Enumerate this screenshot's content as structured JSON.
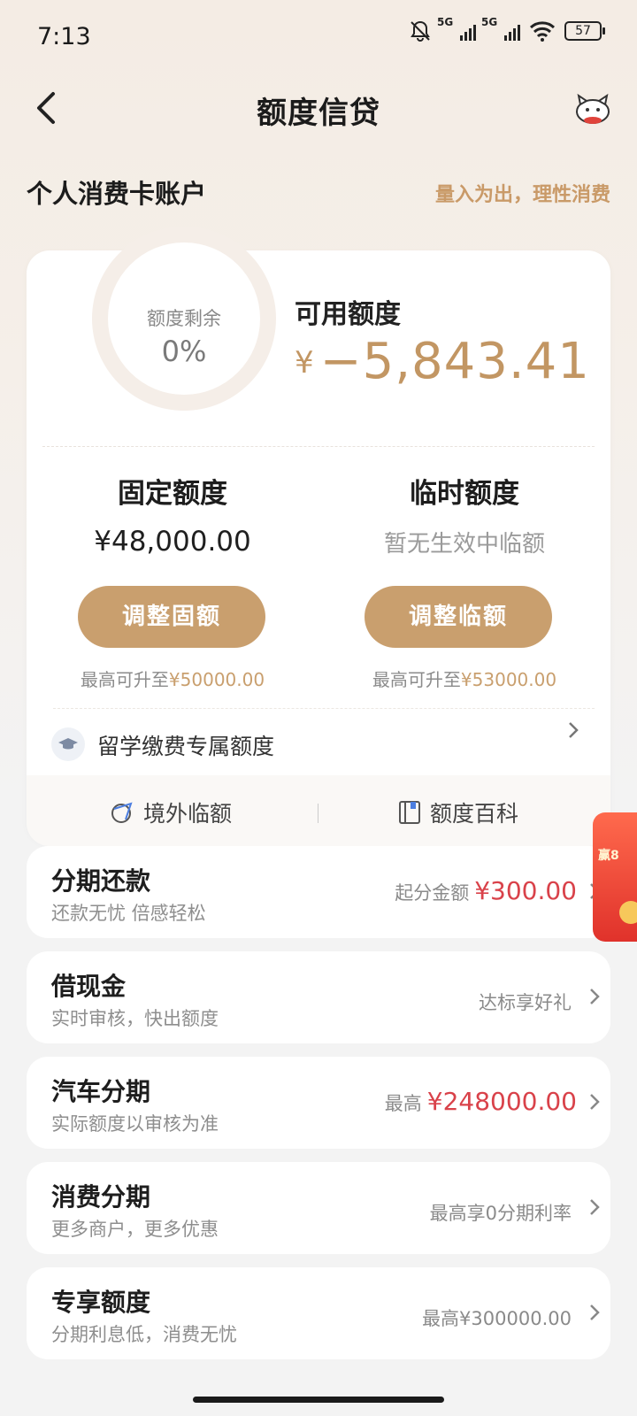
{
  "status_bar": {
    "time": "7:13",
    "signal1_label": "5G",
    "signal2_label": "5G",
    "battery": "57"
  },
  "nav": {
    "title": "额度信贷"
  },
  "section": {
    "title": "个人消费卡账户",
    "slogan": "量入为出，理性消费"
  },
  "quota_ring": {
    "label": "额度剩余",
    "value": "0%",
    "fraction": 0
  },
  "available": {
    "label": "可用额度",
    "currency": "¥",
    "amount": "−5,843.41"
  },
  "fixed": {
    "title": "固定额度",
    "amount": "¥48,000.00",
    "button": "调整固额",
    "max_prefix": "最高可升至",
    "max_value": "¥50000.00"
  },
  "temporary": {
    "title": "临时额度",
    "status": "暂无生效中临额",
    "button": "调整临额",
    "max_prefix": "最高可升至",
    "max_value": "¥53000.00"
  },
  "study": {
    "label": "留学缴费专属额度"
  },
  "footer_links": {
    "overseas": "境外临额",
    "wiki": "额度百科"
  },
  "list": [
    {
      "title": "分期还款",
      "subtitle": "还款无忧 倍感轻松",
      "right_prefix": "起分金额",
      "right_value": "¥300.00"
    },
    {
      "title": "借现金",
      "subtitle": "实时审核，快出额度",
      "right_prefix": "达标享好礼",
      "right_value": ""
    },
    {
      "title": "汽车分期",
      "subtitle": "实际额度以审核为准",
      "right_prefix": "最高",
      "right_value": "¥248000.00"
    },
    {
      "title": "消费分期",
      "subtitle": "更多商户，更多优惠",
      "right_prefix": "最高享0分期利率",
      "right_value": ""
    },
    {
      "title": "专享额度",
      "subtitle": "分期利息低，消费无忧",
      "right_prefix": "最高¥300000.00",
      "right_value": ""
    }
  ],
  "float_promo": {
    "text": "赢8"
  },
  "colors": {
    "accent": "#c99f6e",
    "amount_gold": "#c29663",
    "highlight_red": "#d9424a",
    "background": "#f3f3f3"
  },
  "icons": {
    "back": "chevron-left-icon",
    "mascot": "mascot-icon",
    "study": "graduation-cap-icon",
    "overseas": "globe-plane-icon",
    "wiki": "book-icon",
    "chevron": "chevron-right-icon"
  }
}
